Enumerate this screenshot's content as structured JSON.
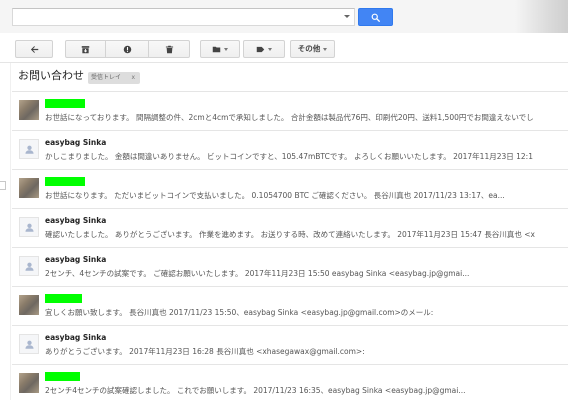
{
  "search": {
    "value": "",
    "options_icon": "chevron-down-icon",
    "button_icon": "search-icon"
  },
  "toolbar": {
    "back_icon": "back-arrow-icon",
    "archive_icon": "archive-icon",
    "spam_icon": "report-spam-icon",
    "delete_icon": "trash-icon",
    "move_icon": "folder-icon",
    "labels_icon": "label-icon",
    "more_label": "その他"
  },
  "thread": {
    "subject": "お問い合わせ",
    "labels": [
      {
        "name": "受信トレイ",
        "remove": "x"
      }
    ]
  },
  "messages": [
    {
      "avatar": "photo-avatar",
      "sender_redacted": true,
      "snippet": "お世話になっております。 間隔調整の件、2cmと4cmで承知しました。 合計金額は製品代76円、印刷代20円、送料1,500円でお間違えないでし"
    },
    {
      "avatar": "default-avatar-icon",
      "sender": "easybag Sinka",
      "snippet": "かしこまりました。 金額は間違いありません。 ビットコインですと、105.47mBTCです。 よろしくお願いいたします。 2017年11月23日 12:1"
    },
    {
      "avatar": "photo-avatar",
      "sender_redacted": true,
      "snippet": "お世話になります。 ただいまビットコインで支払いました。 0.1054700 BTC ご確認ください。 長谷川真也 2017/11/23 13:17、ea..."
    },
    {
      "avatar": "default-avatar-icon",
      "sender": "easybag Sinka",
      "snippet": "確認いたしました。 ありがとうございます。 作業を進めます。 お送りする時、改めて連絡いたします。 2017年11月23日 15:47 長谷川真也 <x"
    },
    {
      "avatar": "default-avatar-icon",
      "sender": "easybag Sinka",
      "snippet": "2センチ、4センチの試案です。 ご確認お願いいたします。 2017年11月23日 15:50 easybag Sinka <easybag.jp@gmai..."
    },
    {
      "avatar": "photo-avatar",
      "sender_redacted": true,
      "snippet": "宜しくお願い致します。 長谷川真也 2017/11/23 15:50、easybag Sinka <easybag.jp@gmail.com>のメール:"
    },
    {
      "avatar": "default-avatar-icon",
      "sender": "easybag Sinka",
      "snippet": "ありがとうございます。 2017年11月23日 16:28 長谷川真也 <xhasegawax@gmail.com>:"
    },
    {
      "avatar": "photo-avatar",
      "sender_redacted": true,
      "snippet": "2センチ4センチの試案確認しました。 これでお願いします。 2017/11/23 16:35、easybag Sinka <easybag.jp@gmai..."
    }
  ],
  "colors": {
    "search_button": "#4285f4",
    "redaction": "#00ff00"
  }
}
